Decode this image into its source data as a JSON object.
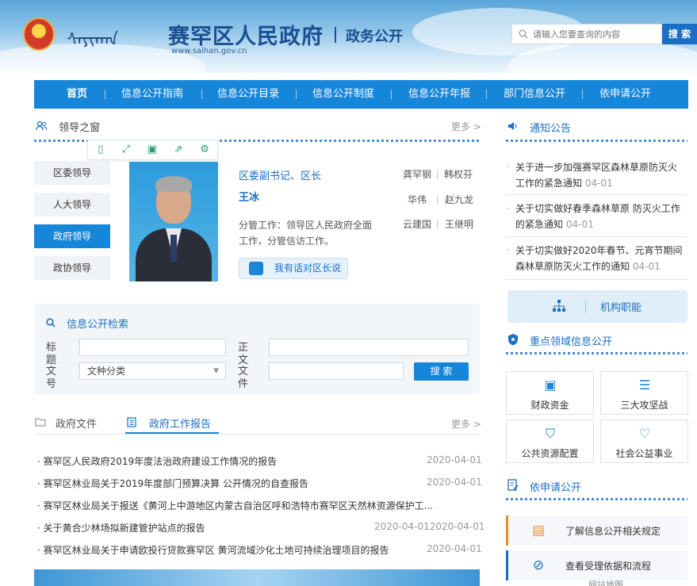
{
  "header": {
    "mongolian_title": "ᠰᠠᠶᠢᠬᠠᠨ",
    "site_title": "赛罕区人民政府",
    "url": "www.saihan.gov.cn",
    "subtitle": "政务公开",
    "search_placeholder": "请输入您要查询的内容",
    "search_button": "搜 索"
  },
  "nav": {
    "items": [
      "首页",
      "信息公开指南",
      "信息公开目录",
      "信息公开制度",
      "信息公开年报",
      "部门信息公开",
      "依申请公开"
    ]
  },
  "leaders": {
    "section_title": "领导之窗",
    "more": "更多 >",
    "tabs": [
      "区委领导",
      "人大领导",
      "政府领导",
      "政协领导"
    ],
    "active_tab": "政府领导",
    "position": "区委副书记、区长",
    "name": "王冰",
    "description": "分管工作：领导区人民政府全面工作，分管信访工作。",
    "talk_button": "我有话对区长说",
    "others": [
      "龚罕钢",
      "韩权芬",
      "华伟",
      "赵九龙",
      "云建国",
      "王继明"
    ]
  },
  "info_search": {
    "title": "信息公开检索",
    "label_title": "标题",
    "label_body": "正文",
    "label_docno": "文号",
    "label_category": "文件分类",
    "select_value": "文种分类",
    "button": "搜 索"
  },
  "documents": {
    "tab_files": "政府文件",
    "tab_reports": "政府工作报告",
    "more": "更多 >",
    "items": [
      {
        "title": "赛罕区人民政府2019年度法治政府建设工作情况的报告",
        "date": "2020-04-01"
      },
      {
        "title": "赛罕区林业局关于2019年度部门预算决算 公开情况的自查报告",
        "date": "2020-04-01"
      },
      {
        "title": "赛罕区林业局关于报送《黄河上中游地区内蒙古自治区呼和浩特市赛罕区天然林资源保护工...",
        "date": ""
      },
      {
        "title": "关于黄合少林场拟新建管护站点的报告",
        "date": "2020-04-012020-04-01"
      },
      {
        "title": "赛罕区林业局关于申请欧投行贷款赛罕区 黄河流域沙化土地可持续治理项目的报告",
        "date": "2020-04-01"
      }
    ]
  },
  "notices": {
    "title": "通知公告",
    "items": [
      {
        "title": "关于进一步加强赛罕区森林草原防灭火工作的紧急通知",
        "date": "04-01"
      },
      {
        "title": "关于切实做好春季森林草原 防灭火工作的紧急通知",
        "date": "04-01"
      },
      {
        "title": "关于切实做好2020年春节、元宵节期间森林草原防灭火工作的通知",
        "date": "04-01"
      }
    ]
  },
  "org_function": "机构职能",
  "key_areas": {
    "title": "重点领域信息公开",
    "cards": [
      "财政资金",
      "三大攻坚战",
      "公共资源配置",
      "社会公益事业"
    ]
  },
  "apply": {
    "title": "依申请公开",
    "items": [
      "了解信息公开相关规定",
      "查看受理依据和流程"
    ]
  },
  "footer_partial": "网站地图"
}
